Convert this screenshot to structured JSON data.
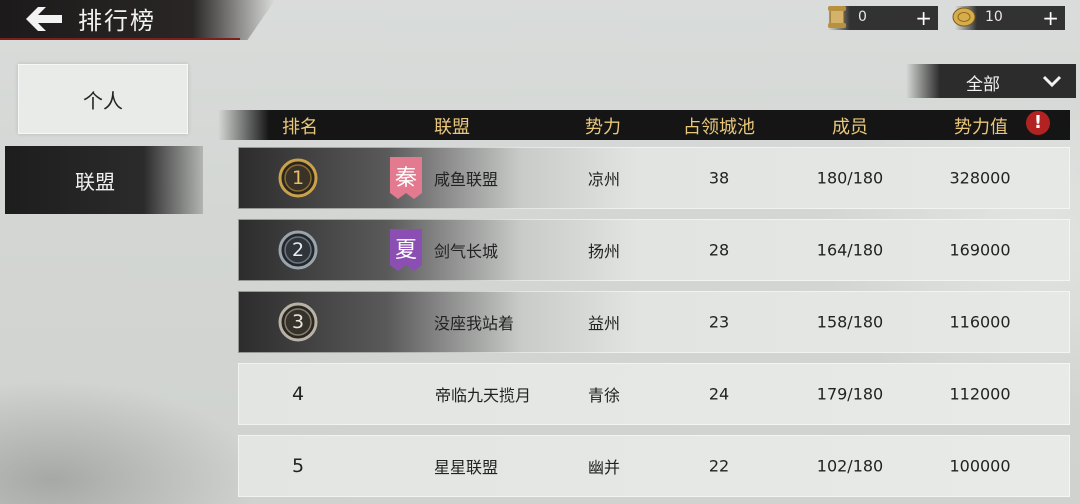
{
  "header": {
    "title": "排行榜",
    "resources": [
      {
        "icon": "scroll-icon",
        "value": "0",
        "plus": "+"
      },
      {
        "icon": "gold-coin-icon",
        "value": "10",
        "plus": "+"
      }
    ]
  },
  "tabs": [
    {
      "label": "个人",
      "selected": false
    },
    {
      "label": "联盟",
      "selected": true
    }
  ],
  "filter": {
    "selected": "全部"
  },
  "table": {
    "columns": [
      "排名",
      "联盟",
      "势力",
      "占领城池",
      "成员",
      "势力值"
    ],
    "warning_icon": "!",
    "rows": [
      {
        "rank": "1",
        "flag": "秦",
        "flag_color": "#e37a8f",
        "name": "咸鱼联盟",
        "region": "凉州",
        "cities": "38",
        "members": "180/180",
        "power": "328000"
      },
      {
        "rank": "2",
        "flag": "夏",
        "flag_color": "#8b4fb4",
        "name": "剑气长城",
        "region": "扬州",
        "cities": "28",
        "members": "164/180",
        "power": "169000"
      },
      {
        "rank": "3",
        "flag": "",
        "flag_color": "",
        "name": "没座我站着",
        "region": "益州",
        "cities": "23",
        "members": "158/180",
        "power": "116000"
      },
      {
        "rank": "4",
        "flag": "",
        "flag_color": "",
        "name": "帝临九天揽月",
        "region": "青徐",
        "cities": "24",
        "members": "179/180",
        "power": "112000"
      },
      {
        "rank": "5",
        "flag": "",
        "flag_color": "",
        "name": "星星联盟",
        "region": "幽并",
        "cities": "22",
        "members": "102/180",
        "power": "100000"
      }
    ]
  },
  "colors": {
    "header_text": "#e9c77a",
    "warning": "#b32222",
    "medal_1": "#c9a24a",
    "medal_2": "#9aa4ad",
    "medal_3": "#b9b2a6"
  }
}
